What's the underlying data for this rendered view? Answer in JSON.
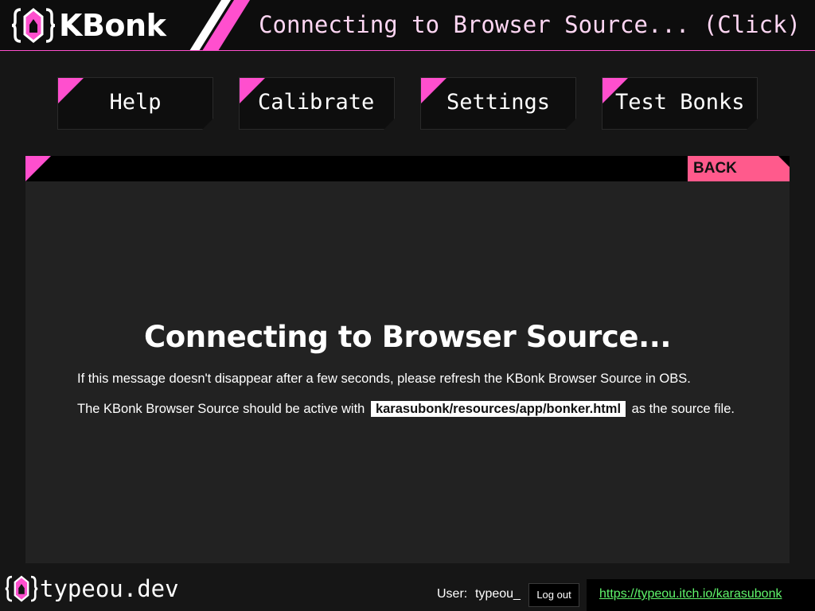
{
  "app": {
    "name": "KBonk",
    "status": "Connecting to Browser Source... (Click)"
  },
  "nav": [
    {
      "label": "Help"
    },
    {
      "label": "Calibrate"
    },
    {
      "label": "Settings"
    },
    {
      "label": "Test Bonks"
    }
  ],
  "panel": {
    "back_label": "BACK",
    "title": "Connecting to Browser Source...",
    "message1": "If this message doesn't disappear after a few seconds, please refresh the KBonk Browser Source in OBS.",
    "message2_prefix": "The KBonk Browser Source should be active with",
    "message2_code": "karasubonk/resources/app/bonker.html",
    "message2_suffix": "as the source file."
  },
  "footer": {
    "brand": "typeou.dev",
    "user_label": "User:",
    "user_name": "typeou_",
    "logout_label": "Log out",
    "link_text": "https://typeou.itch.io/karasubonk"
  },
  "colors": {
    "accent": "#ff4fce",
    "back_button": "#ff5a8c",
    "link": "#5ff56b",
    "panel_bg": "#222222",
    "page_bg": "#161616"
  },
  "icons": {
    "logo": "bracket-shield-logo-icon"
  }
}
